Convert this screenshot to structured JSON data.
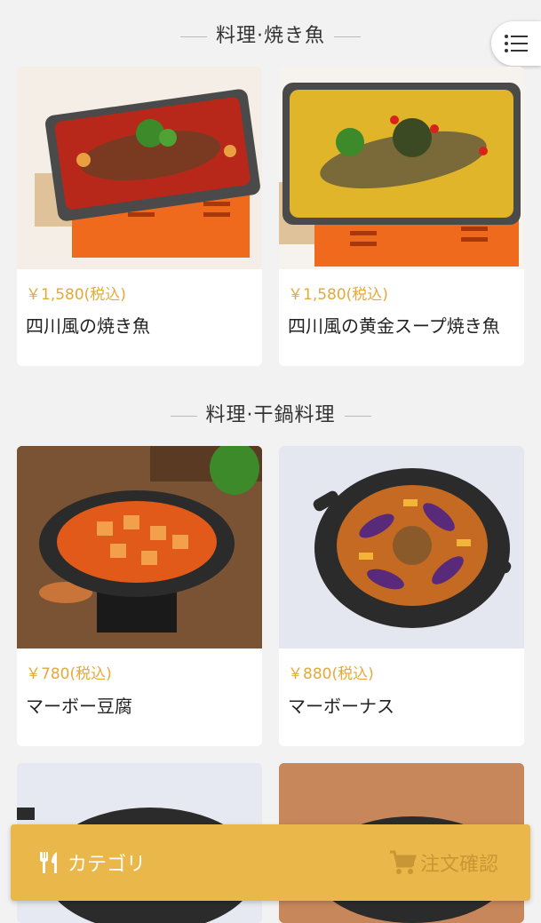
{
  "sections": [
    {
      "title": "料理·焼き魚"
    },
    {
      "title": "料理·干鍋料理"
    }
  ],
  "cards": [
    {
      "price": "￥1,580(税込)",
      "name": "四川風の焼き魚"
    },
    {
      "price": "￥1,580(税込)",
      "name": "四川風の黄金スープ焼き魚"
    },
    {
      "price": "￥780(税込)",
      "name": "マーボー豆腐"
    },
    {
      "price": "￥880(税込)",
      "name": "マーボーナス"
    }
  ],
  "bottom_bar": {
    "category_label": "カテゴリ",
    "order_label": "注文確認"
  },
  "colors": {
    "accent": "#e9b74a",
    "price": "#e3a93a"
  }
}
